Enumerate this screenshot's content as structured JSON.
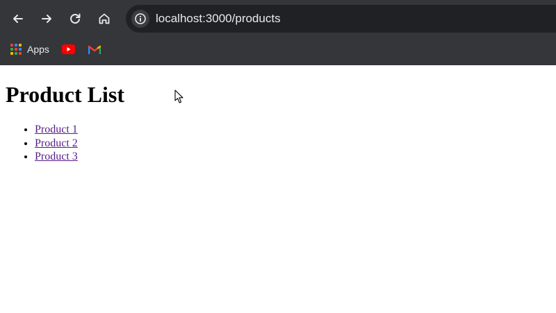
{
  "browser": {
    "url": "localhost:3000/products",
    "bookmarks": [
      {
        "label": "Apps",
        "icon": "apps-grid-icon"
      },
      {
        "label": "",
        "icon": "youtube-icon"
      },
      {
        "label": "",
        "icon": "gmail-icon"
      }
    ],
    "colors": {
      "chrome": "#35363a",
      "omnibox": "#202124",
      "text": "#e8eaed",
      "youtube": "#ff0000"
    }
  },
  "page": {
    "heading": "Product List",
    "products": [
      {
        "label": "Product 1"
      },
      {
        "label": "Product 2"
      },
      {
        "label": "Product 3"
      }
    ],
    "link_color": "#551a8b"
  }
}
